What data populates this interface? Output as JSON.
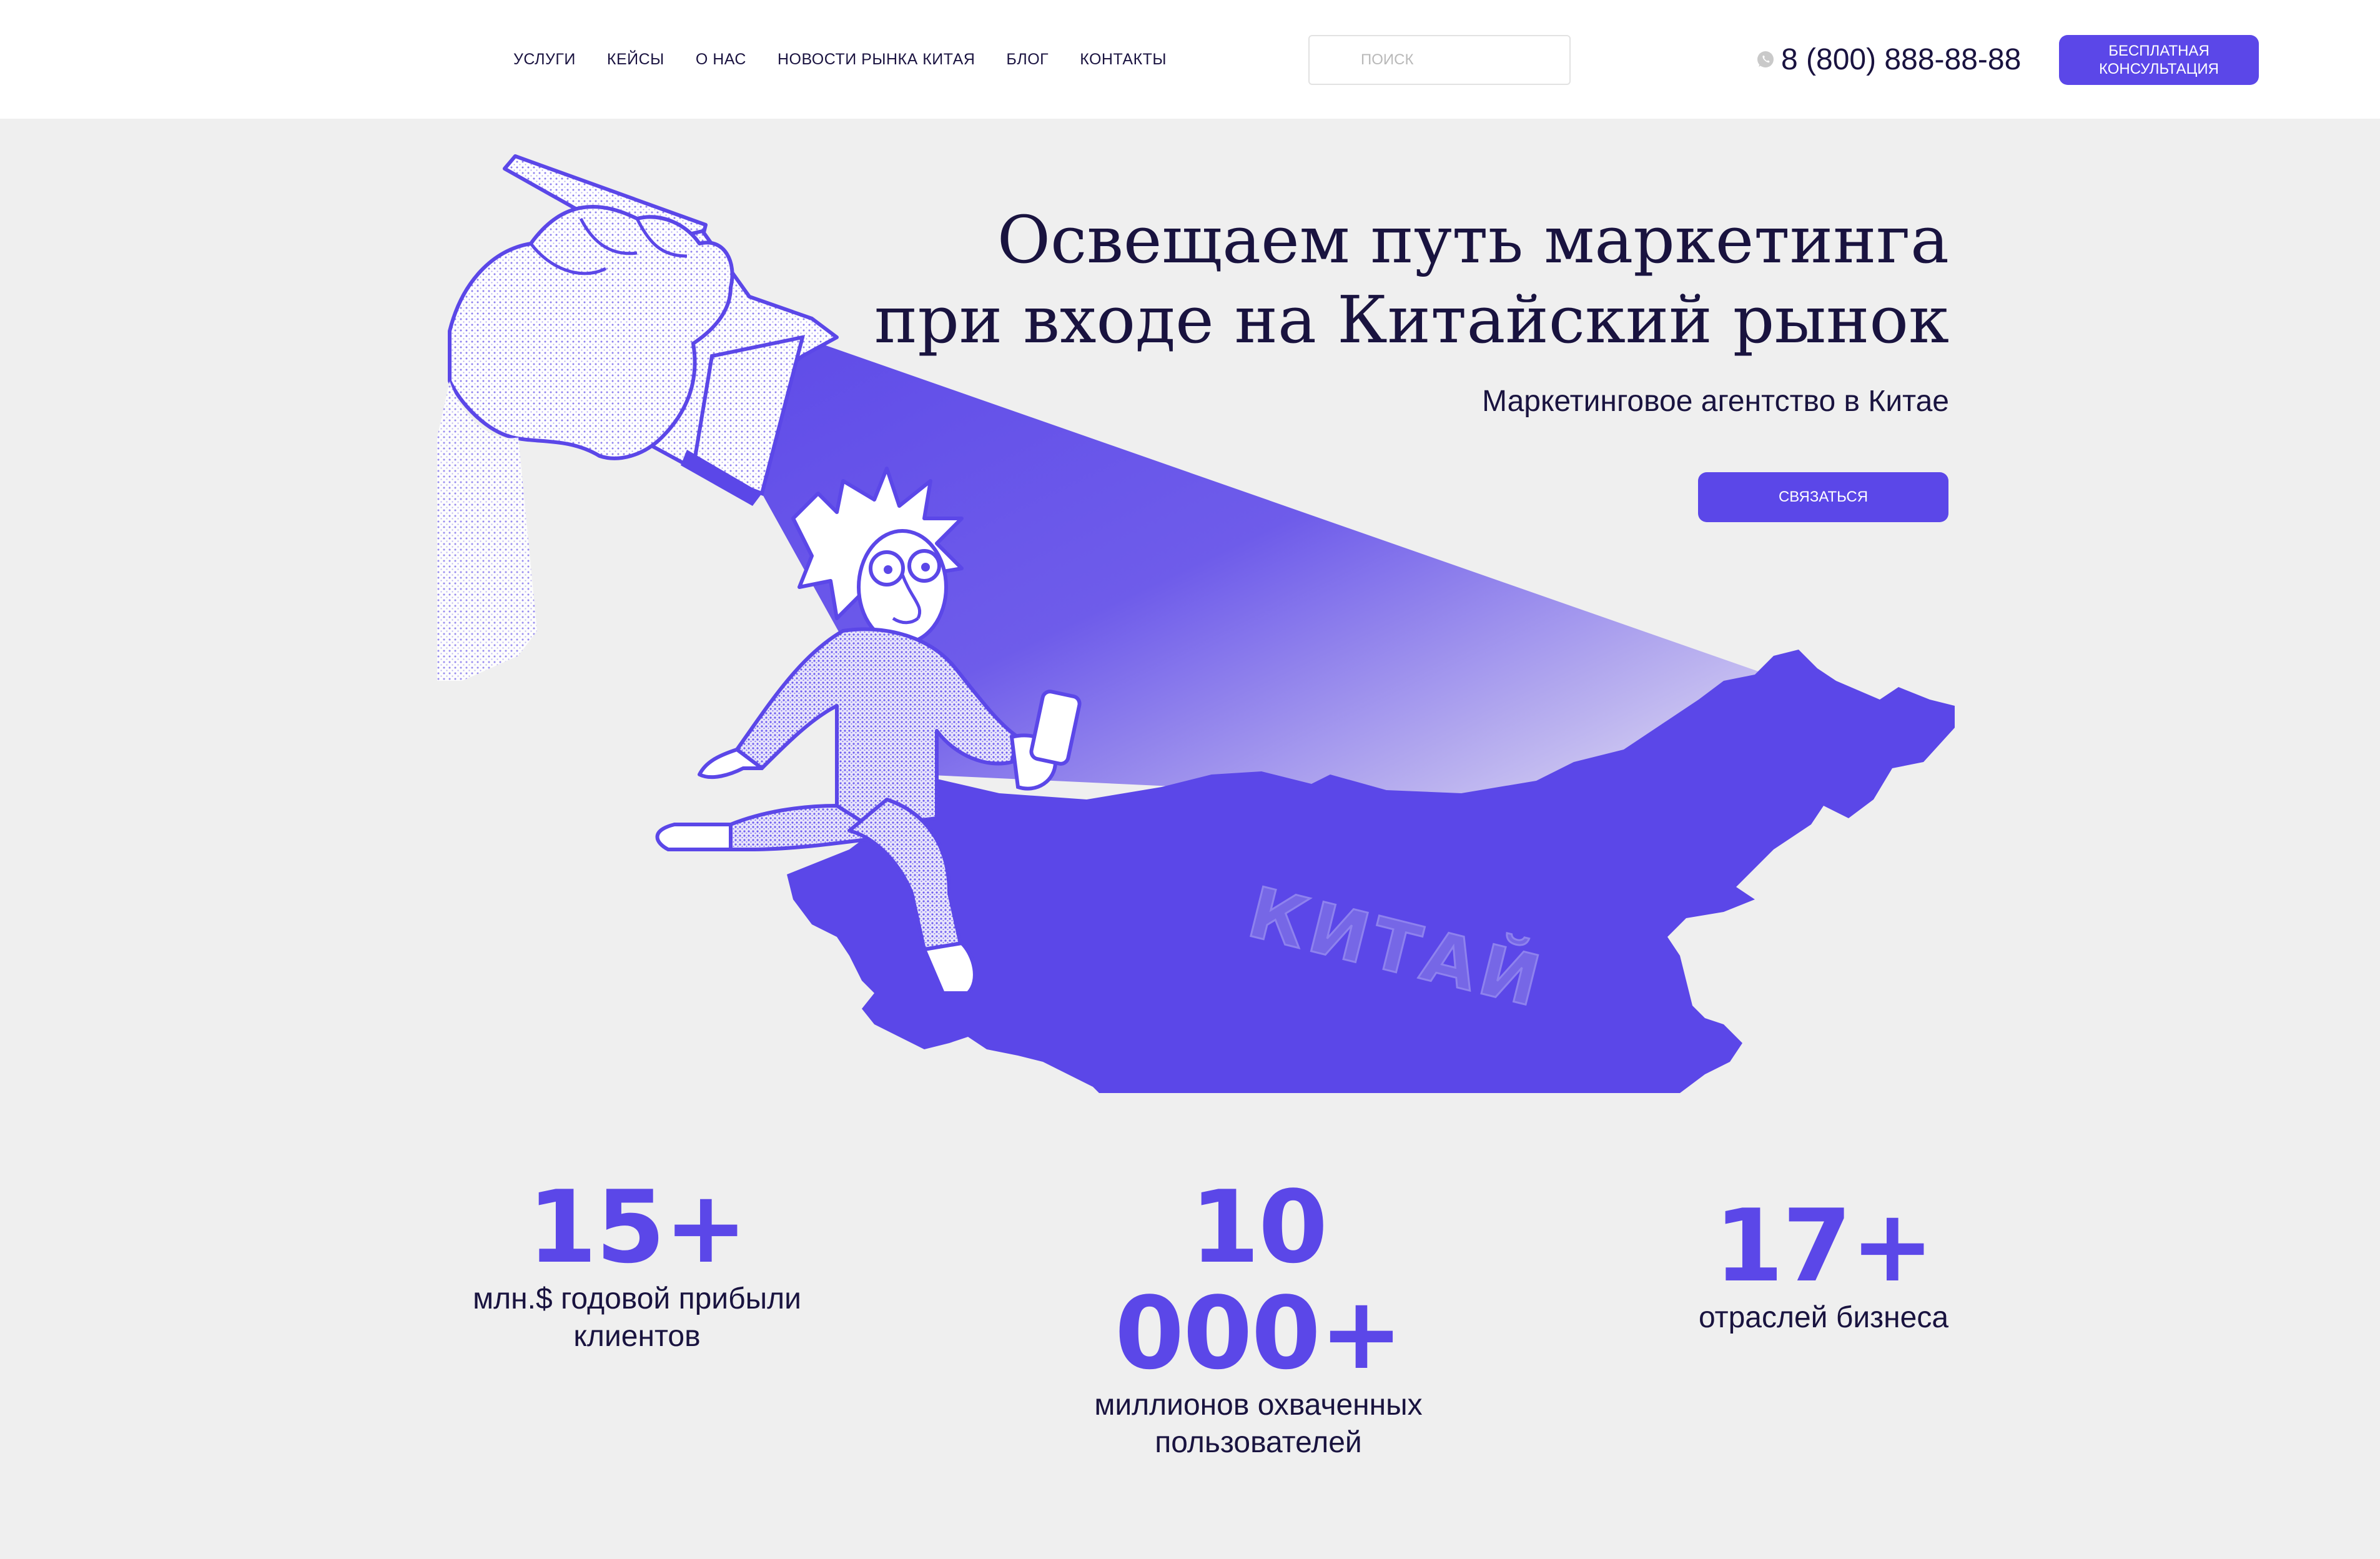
{
  "header": {
    "nav": [
      {
        "label": "УСЛУГИ"
      },
      {
        "label": "КЕЙСЫ"
      },
      {
        "label": "О НАС"
      },
      {
        "label": "НОВОСТИ РЫНКА КИТАЯ"
      },
      {
        "label": "БЛОГ"
      },
      {
        "label": "КОНТАКТЫ"
      }
    ],
    "search": {
      "placeholder": "ПОИСК",
      "value": ""
    },
    "phone": {
      "icon": "whatsapp-icon",
      "number": "8 (800) 888-88-88"
    },
    "cta_label": "БЕСПЛАТНАЯ КОНСУЛЬТАЦИЯ"
  },
  "hero": {
    "title_line1": "Освещаем путь маркетинга",
    "title_line2": "при входе на Китайский рынок",
    "subtitle": "Маркетинговое агентство в Китае",
    "button_label": "СВЯЗАТЬСЯ",
    "map_label": "КИТАЙ"
  },
  "stats": [
    {
      "value": "15+",
      "label": "млн.$ годовой прибыли клиентов"
    },
    {
      "value": "10 000+",
      "label": "миллионов охваченных пользователей"
    },
    {
      "value": "17+",
      "label": "отраслей бизнеса"
    }
  ],
  "colors": {
    "accent": "#5b47e8",
    "text": "#19133f",
    "background": "#efefef",
    "header": "#ffffff"
  }
}
